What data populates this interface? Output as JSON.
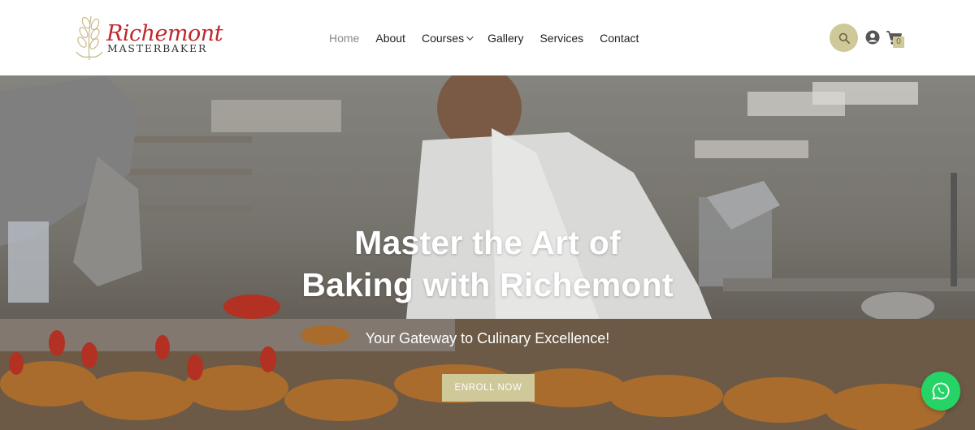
{
  "brand": {
    "name": "Richemont",
    "subtitle": "MASTERBAKER"
  },
  "nav": {
    "items": [
      {
        "label": "Home",
        "active": true
      },
      {
        "label": "About",
        "active": false
      },
      {
        "label": "Courses",
        "active": false,
        "has_dropdown": true
      },
      {
        "label": "Gallery",
        "active": false
      },
      {
        "label": "Services",
        "active": false
      },
      {
        "label": "Contact",
        "active": false
      }
    ]
  },
  "header_actions": {
    "search_icon": "search-icon",
    "account_icon": "account-icon",
    "cart_icon": "cart-icon",
    "cart_count": "0"
  },
  "hero": {
    "title_line1": "Master the Art of",
    "title_line2": "Baking with Richemont",
    "subtitle": "Your Gateway to Culinary Excellence!",
    "cta_label": "ENROLL NOW"
  },
  "floating": {
    "whatsapp_icon": "whatsapp-icon"
  },
  "colors": {
    "accent": "#cfc898",
    "brand_red": "#c0272d",
    "whatsapp_green": "#25d366",
    "nav_active": "#8a8a8a",
    "nav_text": "#222222"
  }
}
